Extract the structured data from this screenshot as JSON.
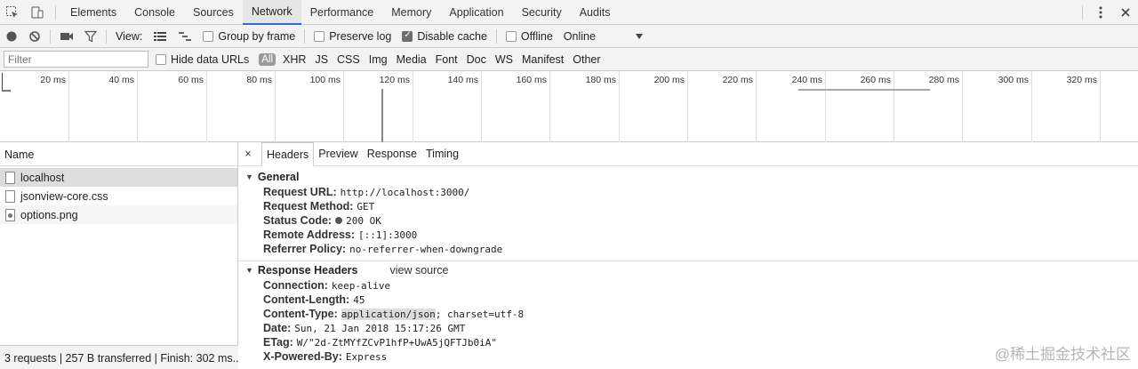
{
  "tabs": [
    "Elements",
    "Console",
    "Sources",
    "Network",
    "Performance",
    "Memory",
    "Application",
    "Security",
    "Audits"
  ],
  "active_tab": "Network",
  "toolbar": {
    "view_label": "View:",
    "group_by_frame": "Group by frame",
    "preserve_log": "Preserve log",
    "disable_cache": "Disable cache",
    "offline": "Offline",
    "throttle": "Online"
  },
  "filterbar": {
    "placeholder": "Filter",
    "hide_data_urls": "Hide data URLs",
    "types": [
      "All",
      "XHR",
      "JS",
      "CSS",
      "Img",
      "Media",
      "Font",
      "Doc",
      "WS",
      "Manifest",
      "Other"
    ]
  },
  "timeline": {
    "labels": [
      "20 ms",
      "40 ms",
      "60 ms",
      "80 ms",
      "100 ms",
      "120 ms",
      "140 ms",
      "160 ms",
      "180 ms",
      "200 ms",
      "220 ms",
      "240 ms",
      "260 ms",
      "280 ms",
      "300 ms",
      "320 ms"
    ]
  },
  "requests": {
    "header": "Name",
    "items": [
      "localhost",
      "jsonview-core.css",
      "options.png"
    ],
    "footer": "3 requests | 257 B transferred | Finish: 302 ms..."
  },
  "detail": {
    "close": "×",
    "tabs": [
      "Headers",
      "Preview",
      "Response",
      "Timing"
    ],
    "general": {
      "title": "General",
      "request_url_k": "Request URL:",
      "request_url_v": "http://localhost:3000/",
      "request_method_k": "Request Method:",
      "request_method_v": "GET",
      "status_code_k": "Status Code:",
      "status_code_v": "200 OK",
      "remote_address_k": "Remote Address:",
      "remote_address_v": "[::1]:3000",
      "referrer_policy_k": "Referrer Policy:",
      "referrer_policy_v": "no-referrer-when-downgrade"
    },
    "response": {
      "title": "Response Headers",
      "view_source": "view source",
      "connection_k": "Connection:",
      "connection_v": "keep-alive",
      "content_length_k": "Content-Length:",
      "content_length_v": "45",
      "content_type_k": "Content-Type:",
      "content_type_v1": "application/json",
      "content_type_v2": "; charset=utf-8",
      "date_k": "Date:",
      "date_v": "Sun, 21 Jan 2018 15:17:26 GMT",
      "etag_k": "ETag:",
      "etag_v": "W/\"2d-ZtMYfZCvP1hfP+UwA5jQFTJb0iA\"",
      "powered_k": "X-Powered-By:",
      "powered_v": "Express"
    }
  },
  "watermark": "@稀土掘金技术社区"
}
